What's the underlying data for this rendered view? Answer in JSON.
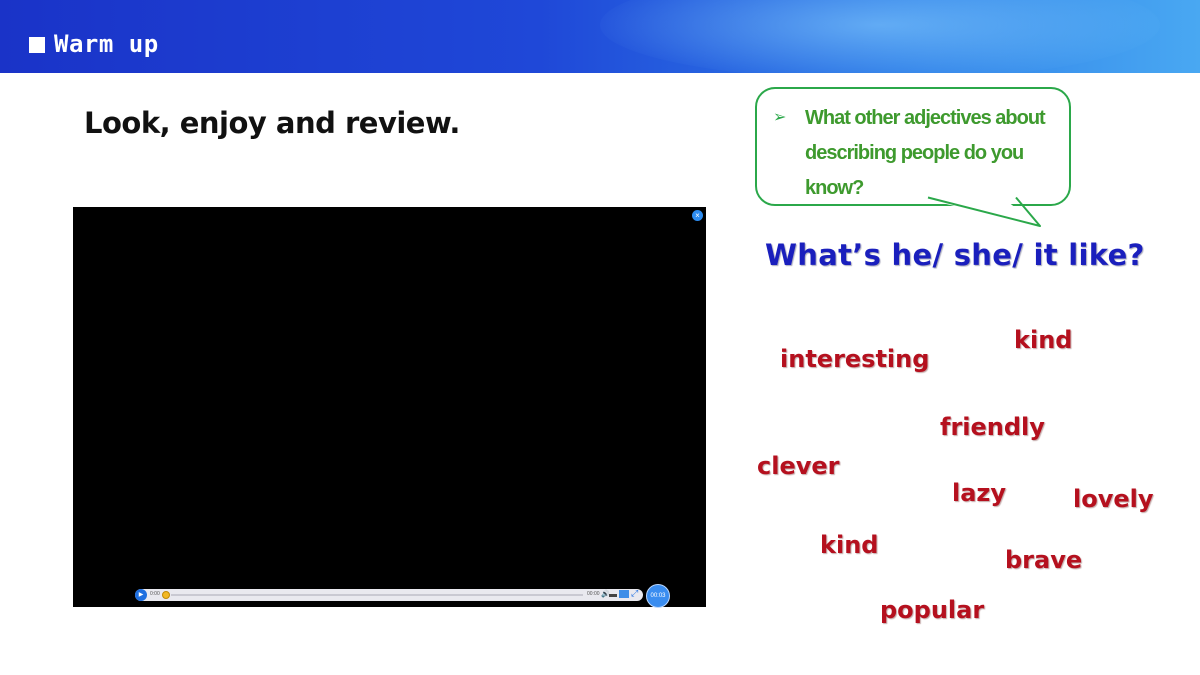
{
  "header": {
    "title": "Warm up"
  },
  "instruction": "Look, enjoy and review.",
  "video": {
    "close_glyph": "×",
    "play_glyph": "▶",
    "time_start": "0:00",
    "time_end": "00:00",
    "timer": "00:03",
    "volume_glyph": "🔊",
    "expand_glyph": "⤢"
  },
  "bubble": {
    "arrow_glyph": "➢",
    "text": "What other adjectives about describing people do you know?"
  },
  "question": "What’s he/ she/ it like?",
  "words": [
    "kind",
    "interesting",
    "friendly",
    "clever",
    "lazy",
    "lovely",
    "kind",
    "brave",
    "popular"
  ],
  "colors": {
    "header": "#1f48d8",
    "bubble_border": "#2ba84a",
    "question": "#1a1fbd",
    "words": "#b5101e"
  }
}
